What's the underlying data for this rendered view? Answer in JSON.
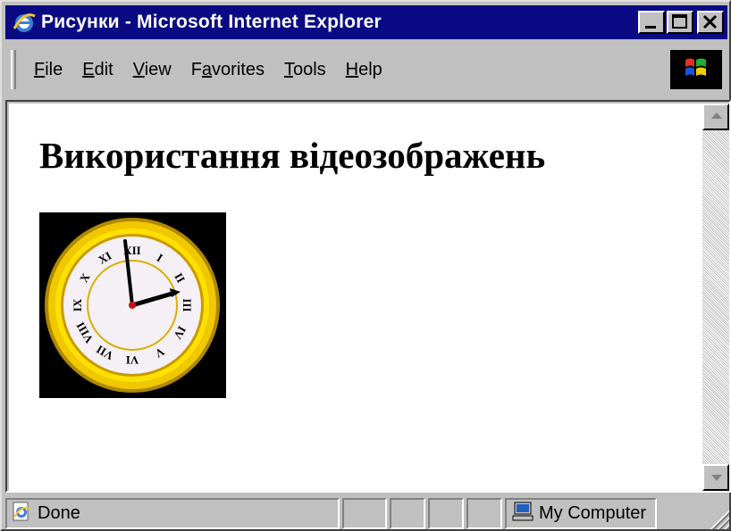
{
  "window": {
    "title": "Рисунки - Microsoft Internet Explorer",
    "minimize_icon": "minimize-icon",
    "maximize_icon": "maximize-icon",
    "close_icon": "close-icon"
  },
  "menu": {
    "items": [
      {
        "pre": "",
        "key": "F",
        "post": "ile"
      },
      {
        "pre": "",
        "key": "E",
        "post": "dit"
      },
      {
        "pre": "",
        "key": "V",
        "post": "iew"
      },
      {
        "pre": "F",
        "key": "a",
        "post": "vorites"
      },
      {
        "pre": "",
        "key": "T",
        "post": "ools"
      },
      {
        "pre": "",
        "key": "H",
        "post": "elp"
      }
    ]
  },
  "page": {
    "heading": "Використання відеозображень",
    "image_icon": "clock-icon",
    "clock_numerals": [
      "XII",
      "I",
      "II",
      "III",
      "IV",
      "V",
      "VI",
      "VII",
      "VIII",
      "IX",
      "X",
      "XI"
    ]
  },
  "status": {
    "text": "Done",
    "zone": "My Computer"
  },
  "colors": {
    "titlebar": "#0a0a84",
    "chrome": "#c0c0c0",
    "clock_rim": "#f0c800"
  }
}
